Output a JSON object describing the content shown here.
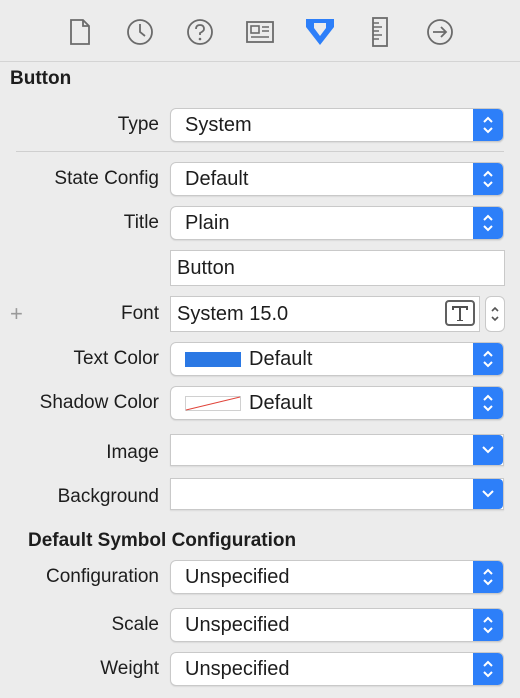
{
  "toolbar": {
    "tabs": [
      {
        "icon": "file-icon"
      },
      {
        "icon": "history-clock-icon"
      },
      {
        "icon": "help-icon"
      },
      {
        "icon": "identity-inspector-icon"
      },
      {
        "icon": "attributes-inspector-icon",
        "selected": true
      },
      {
        "icon": "size-inspector-ruler-icon"
      },
      {
        "icon": "connections-arrow-icon"
      }
    ],
    "accent": "#2d7ff9"
  },
  "button_section": {
    "title": "Button",
    "type_label": "Type",
    "type_value": "System",
    "state_config_label": "State Config",
    "state_config_value": "Default",
    "title_label": "Title",
    "title_value": "Plain",
    "title_text": "Button",
    "font_label": "Font",
    "font_value": "System 15.0",
    "text_color_label": "Text Color",
    "text_color_value": "Default",
    "text_color_swatch": "#2a78e4",
    "shadow_color_label": "Shadow Color",
    "shadow_color_value": "Default",
    "image_label": "Image",
    "image_value": "",
    "background_label": "Background",
    "background_value": ""
  },
  "symbol_section": {
    "title": "Default Symbol Configuration",
    "configuration_label": "Configuration",
    "configuration_value": "Unspecified",
    "scale_label": "Scale",
    "scale_value": "Unspecified",
    "weight_label": "Weight",
    "weight_value": "Unspecified"
  }
}
